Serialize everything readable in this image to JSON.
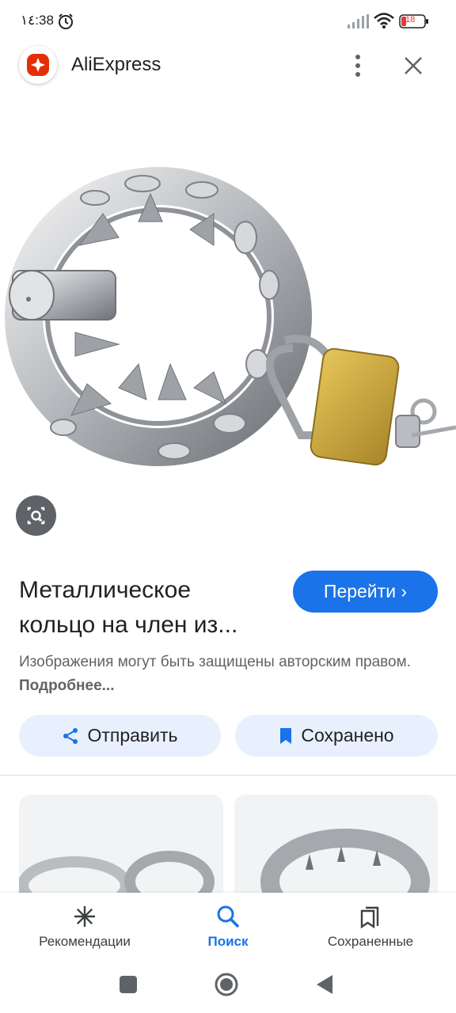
{
  "status_bar": {
    "time": "١٤:38",
    "battery": "18"
  },
  "header": {
    "app_name": "AliExpress"
  },
  "product": {
    "title": "Металлическое кольцо на член из...",
    "go_button_label": "Перейти ›",
    "copyright_text": "Изображения могут быть защищены авторским правом.",
    "more_link": "Подробнее..."
  },
  "actions": {
    "share_label": "Отправить",
    "save_label": "Сохранено"
  },
  "bottom_nav": {
    "items": [
      {
        "label": "Рекомендации",
        "icon": "asterisk-icon"
      },
      {
        "label": "Поиск",
        "icon": "search-icon",
        "active": true
      },
      {
        "label": "Сохраненные",
        "icon": "collections-icon"
      }
    ]
  },
  "colors": {
    "accent": "#1a73e8",
    "action_bg": "#e8f0fe",
    "brand_red": "#e62e04"
  }
}
